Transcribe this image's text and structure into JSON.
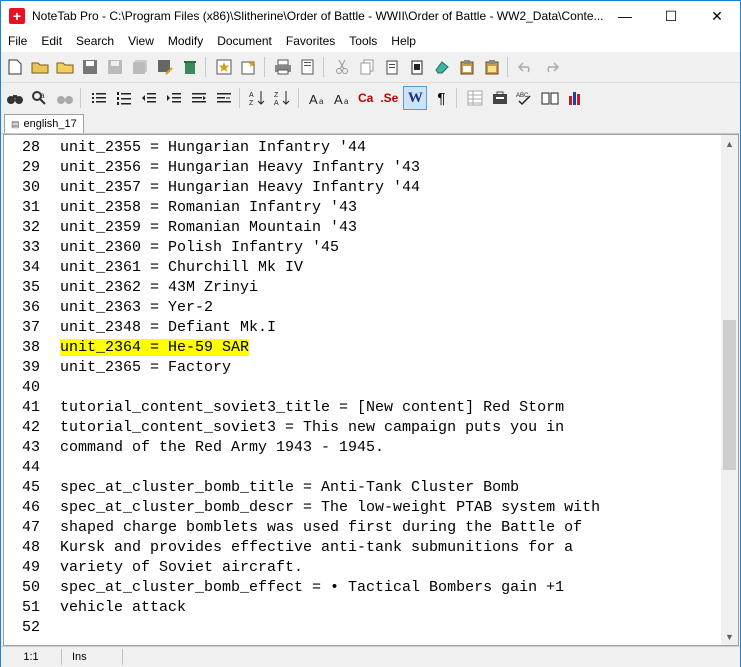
{
  "window": {
    "title": "NoteTab Pro  -  C:\\Program Files (x86)\\Slitherine\\Order of Battle - WWII\\Order of Battle - WW2_Data\\Conte..."
  },
  "titlebar": {
    "minimize": "—",
    "maximize": "☐",
    "close": "✕"
  },
  "menu": [
    "File",
    "Edit",
    "Search",
    "View",
    "Modify",
    "Document",
    "Favorites",
    "Tools",
    "Help"
  ],
  "toolbar1": [
    "new-file-icon",
    "open-folder-icon",
    "open-folder-yellow-icon",
    "save-icon",
    "save-disabled-icon",
    "save-all-disabled-icon",
    "save-as-icon",
    "trash-icon",
    "sep",
    "star-icon",
    "favorites-icon",
    "sep",
    "print-icon",
    "print-preview-icon",
    "sep",
    "cut-icon",
    "copy-icon",
    "paste-icon",
    "paste-special-icon",
    "eraser-icon",
    "clipboard-icon",
    "clipboard-2-icon",
    "sep",
    "undo-icon",
    "redo-icon"
  ],
  "toolbar2": [
    "find-icon",
    "find-replace-icon",
    "find-next-icon",
    "sep",
    "bullets-icon",
    "numbering-icon",
    "outdent-icon",
    "indent-icon",
    "align-icon",
    "wrap-icon",
    "sep",
    "sort-asc-icon",
    "sort-desc-icon",
    "sep",
    "font-smaller-icon",
    "font-larger-icon",
    "case-icon",
    "spell-icon",
    "word-wrap-icon",
    "paragraph-icon",
    "sep",
    "grid-icon",
    "briefcase-icon",
    "spellcheck-icon",
    "book-icon",
    "chart-icon"
  ],
  "toolbar2_labels": {
    "case": "Ca",
    "spell": ".Se",
    "word": "W",
    "para": "¶"
  },
  "tab": {
    "label": "english_17"
  },
  "editor": {
    "lines": [
      {
        "n": "28",
        "t": "unit_2355 = Hungarian Infantry '44"
      },
      {
        "n": "29",
        "t": "unit_2356 = Hungarian Heavy Infantry '43"
      },
      {
        "n": "30",
        "t": "unit_2357 = Hungarian Heavy Infantry '44"
      },
      {
        "n": "31",
        "t": "unit_2358 = Romanian Infantry '43"
      },
      {
        "n": "32",
        "t": "unit_2359 = Romanian Mountain '43"
      },
      {
        "n": "33",
        "t": "unit_2360 = Polish Infantry '45"
      },
      {
        "n": "34",
        "t": "unit_2361 = Churchill Mk IV"
      },
      {
        "n": "35",
        "t": "unit_2362 = 43M Zrinyi"
      },
      {
        "n": "36",
        "t": "unit_2363 = Yer-2"
      },
      {
        "n": "37",
        "t": "unit_2348 = Defiant Mk.I"
      },
      {
        "n": "38",
        "t": "unit_2364 = He-59 SAR"
      },
      {
        "n": "39",
        "t": "unit_2365 = Factory"
      },
      {
        "n": "40",
        "t": ""
      },
      {
        "n": "41",
        "t": "tutorial_content_soviet3_title = [New content] Red Storm"
      },
      {
        "n": "42",
        "t": "tutorial_content_soviet3 = This new campaign puts you in"
      },
      {
        "n": "43",
        "t": "command of the Red Army 1943 - 1945."
      },
      {
        "n": "44",
        "t": ""
      },
      {
        "n": "45",
        "t": "spec_at_cluster_bomb_title = Anti-Tank Cluster Bomb"
      },
      {
        "n": "46",
        "t": "spec_at_cluster_bomb_descr = The low-weight PTAB system with"
      },
      {
        "n": "47",
        "t": "shaped charge bomblets was used first during the Battle of"
      },
      {
        "n": "48",
        "t": "Kursk and provides effective anti-tank submunitions for a"
      },
      {
        "n": "49",
        "t": "variety of Soviet aircraft."
      },
      {
        "n": "50",
        "t": "spec_at_cluster_bomb_effect = • Tactical Bombers gain +1"
      },
      {
        "n": "51",
        "t": "vehicle attack"
      },
      {
        "n": "52",
        "t": ""
      }
    ],
    "highlight_line": "38",
    "highlight_color": "#ffff00"
  },
  "status": {
    "position": "1:1",
    "mode": "Ins"
  }
}
